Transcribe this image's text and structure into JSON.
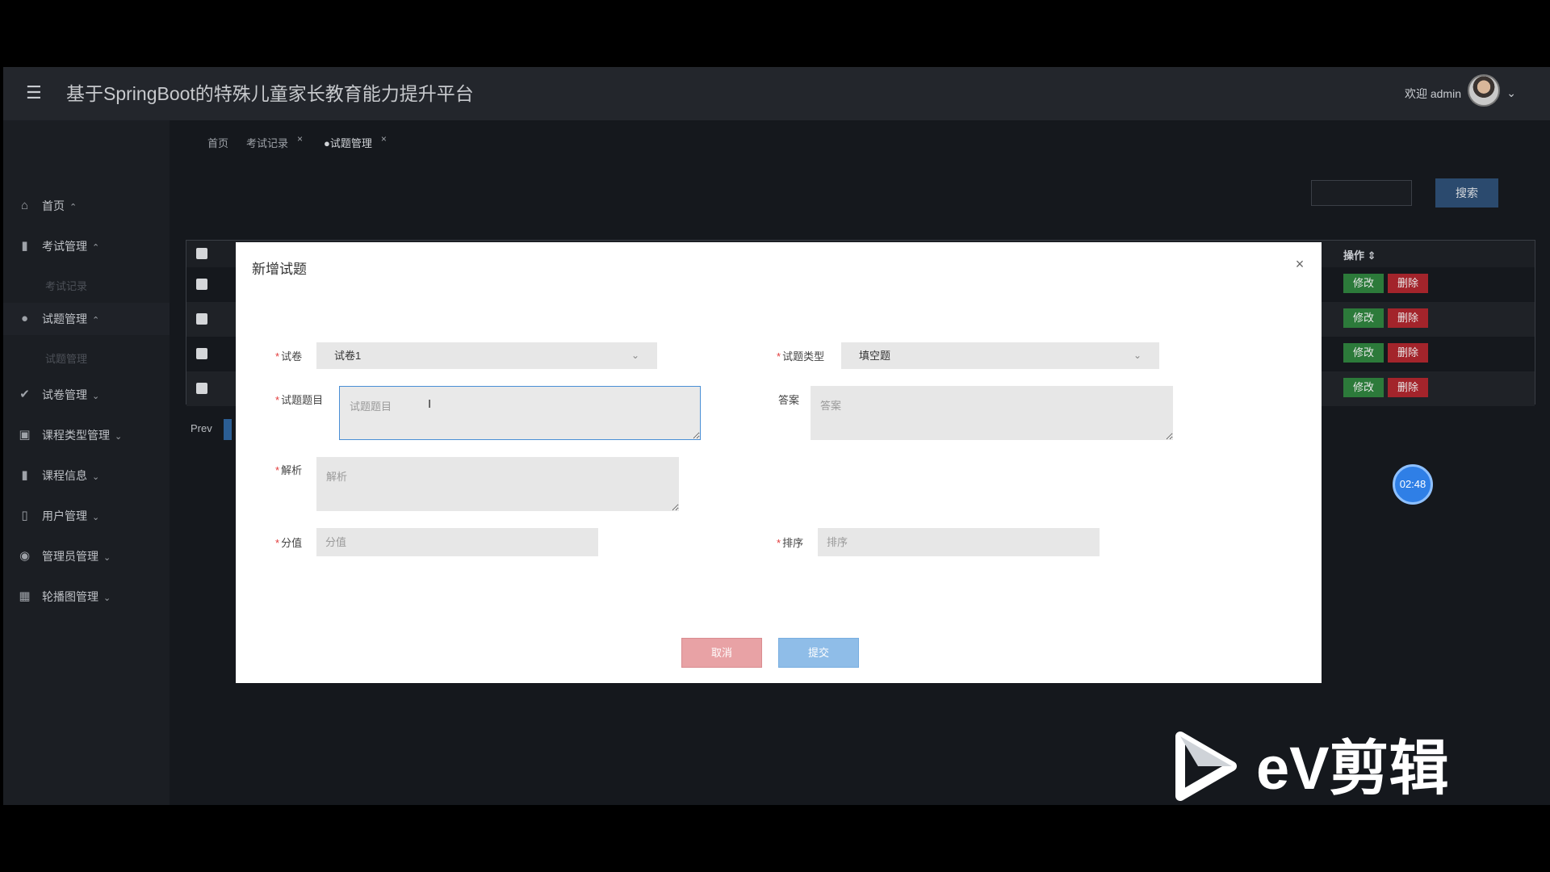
{
  "header": {
    "menu_icon": "hamburger-icon",
    "title": "基于SpringBoot的特殊儿童家长教育能力提升平台",
    "welcome": "欢迎 admin"
  },
  "sidebar": {
    "items": [
      {
        "label": "首页",
        "icon": "home-icon"
      },
      {
        "label": "考试管理",
        "icon": "book-icon"
      },
      {
        "label": "考试记录",
        "sub": true
      },
      {
        "label": "试题管理",
        "icon": "question-icon"
      },
      {
        "label": "试题管理",
        "sub": true
      },
      {
        "label": "试卷管理",
        "icon": "check-circle-icon"
      },
      {
        "label": "课程类型管理",
        "icon": "briefcase-icon"
      },
      {
        "label": "课程信息",
        "icon": "book-icon"
      },
      {
        "label": "用户管理",
        "icon": "columns-icon"
      },
      {
        "label": "管理员管理",
        "icon": "dot-circle-icon"
      },
      {
        "label": "轮播图管理",
        "icon": "table-icon"
      }
    ]
  },
  "tabs": [
    {
      "label": "首页"
    },
    {
      "label": "考试记录",
      "close": "×"
    },
    {
      "label": "●试题管理",
      "close": "×"
    }
  ],
  "background": {
    "search_button": "搜索",
    "table_header_op": "操作 ⇕",
    "row_edit": "修改",
    "row_delete": "删除",
    "prev": "Prev",
    "timer": "02:48"
  },
  "modal": {
    "title": "新增试题",
    "close": "×",
    "fields": {
      "paper": {
        "label": "试卷",
        "value": "试卷1"
      },
      "type": {
        "label": "试题类型",
        "value": "填空题"
      },
      "question": {
        "label": "试题题目",
        "placeholder": "试题题目"
      },
      "answer": {
        "label": "答案",
        "placeholder": "答案"
      },
      "analysis": {
        "label": "解析",
        "placeholder": "解析"
      },
      "score": {
        "label": "分值",
        "placeholder": "分值"
      },
      "order": {
        "label": "排序",
        "placeholder": "排序"
      }
    },
    "cancel": "取消",
    "submit": "提交",
    "required_mark": "*"
  },
  "watermark": {
    "text": "eV剪辑"
  },
  "colors": {
    "cancel": "#e8a2a5",
    "submit": "#8fbde8",
    "edit": "#2c7a3a",
    "delete": "#a3242b",
    "timer": "#2f7fe6"
  }
}
